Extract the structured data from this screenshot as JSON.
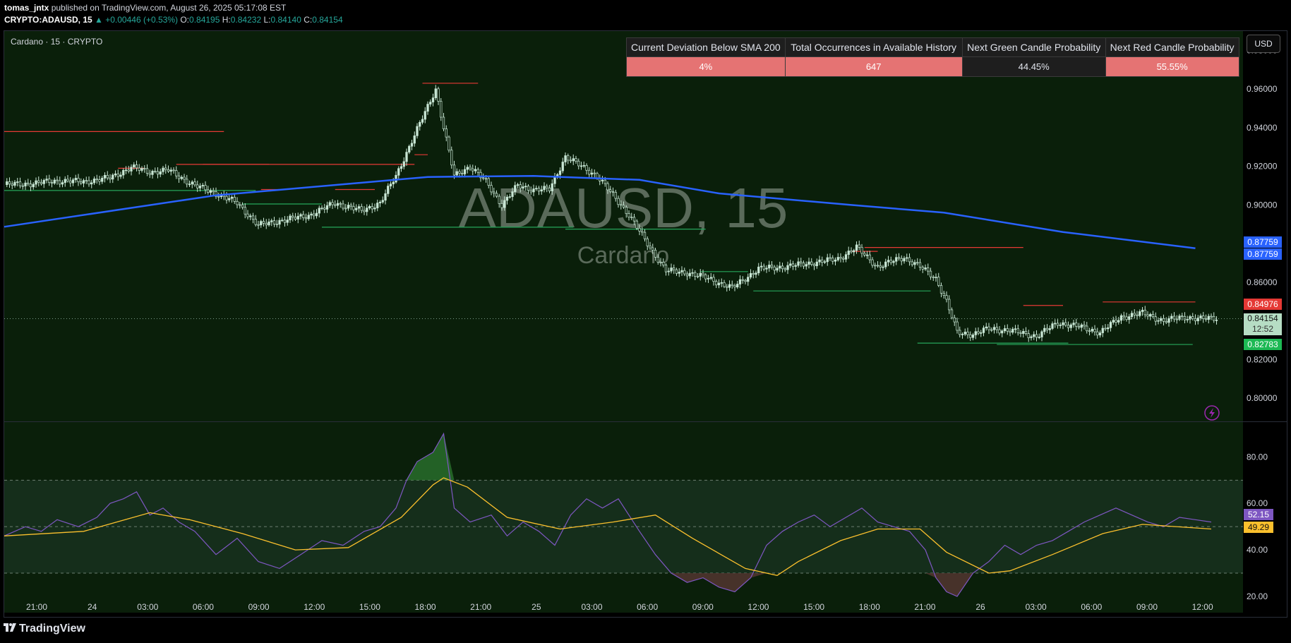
{
  "header": {
    "author": "tomas_jntx",
    "published_text": "published on TradingView.com, August 26, 2025 05:17:08 EST",
    "symbol": "CRYPTO:ADAUSD, 15",
    "change": "▲ +0.00446 (+0.53%)",
    "o_label": "O:",
    "o_value": "0.84195",
    "h_label": "H:",
    "h_value": "0.84232",
    "l_label": "L:",
    "l_value": "0.84140",
    "c_label": "C:",
    "c_value": "0.84154"
  },
  "pane_title": "Cardano · 15 · CRYPTO",
  "watermark": {
    "symbol": "ADAUSD, 15",
    "name": "Cardano"
  },
  "currency_button": "USD",
  "table": {
    "headers": [
      "Current Deviation Below SMA 200",
      "Total Occurrences in Available History",
      "Next Green Candle Probability",
      "Next Red Candle Probability"
    ],
    "values": [
      "4%",
      "647",
      "44.45%",
      "55.55%"
    ]
  },
  "badges": {
    "sma1": "0.87759",
    "sma2": "0.87759",
    "resistance": "0.84976",
    "last_price": "0.84154",
    "countdown": "12:52",
    "support": "0.82783",
    "rsi": "52.15",
    "rsi_ma": "49.29"
  },
  "colors": {
    "background": "#0a1f0a",
    "bull": "#c8e6d4",
    "bear": "#0a1f0a",
    "sma": "#2962ff",
    "resistance": "#e53935",
    "support": "#26a65b",
    "rsi": "#7e57c2",
    "rsi_ma": "#fbc02d"
  },
  "footer": {
    "brand": "TradingView"
  },
  "chart_data": [
    {
      "type": "candlestick",
      "title": "Cardano · 15 · CRYPTO",
      "ylim": [
        0.788,
        0.99
      ],
      "y_ticks": [
        "0.98000",
        "0.96000",
        "0.94000",
        "0.92000",
        "0.90000",
        "0.88000",
        "0.86000",
        "0.84000",
        "0.82000",
        "0.80000"
      ],
      "x_ticks": [
        "21:00",
        "24",
        "03:00",
        "06:00",
        "09:00",
        "12:00",
        "15:00",
        "18:00",
        "21:00",
        "25",
        "03:00",
        "06:00",
        "09:00",
        "12:00",
        "15:00",
        "18:00",
        "21:00",
        "26",
        "03:00",
        "06:00",
        "09:00",
        "12:00"
      ],
      "close_path": [
        [
          0,
          0.9105
        ],
        [
          10,
          0.911
        ],
        [
          20,
          0.9125
        ],
        [
          30,
          0.912
        ],
        [
          40,
          0.914
        ],
        [
          48,
          0.9195
        ],
        [
          55,
          0.917
        ],
        [
          62,
          0.918
        ],
        [
          72,
          0.91
        ],
        [
          80,
          0.906
        ],
        [
          88,
          0.901
        ],
        [
          96,
          0.8895
        ],
        [
          105,
          0.892
        ],
        [
          115,
          0.8945
        ],
        [
          125,
          0.901
        ],
        [
          135,
          0.897
        ],
        [
          142,
          0.901
        ],
        [
          148,
          0.915
        ],
        [
          153,
          0.93
        ],
        [
          158,
          0.945
        ],
        [
          163,
          0.96
        ],
        [
          166,
          0.94
        ],
        [
          170,
          0.915
        ],
        [
          176,
          0.92
        ],
        [
          182,
          0.912
        ],
        [
          188,
          0.9
        ],
        [
          194,
          0.91
        ],
        [
          200,
          0.908
        ],
        [
          206,
          0.908
        ],
        [
          212,
          0.925
        ],
        [
          218,
          0.92
        ],
        [
          224,
          0.915
        ],
        [
          230,
          0.905
        ],
        [
          236,
          0.895
        ],
        [
          242,
          0.882
        ],
        [
          250,
          0.866
        ],
        [
          258,
          0.865
        ],
        [
          266,
          0.862
        ],
        [
          275,
          0.857
        ],
        [
          285,
          0.867
        ],
        [
          295,
          0.868
        ],
        [
          305,
          0.87
        ],
        [
          315,
          0.872
        ],
        [
          322,
          0.878
        ],
        [
          330,
          0.868
        ],
        [
          340,
          0.873
        ],
        [
          346,
          0.868
        ],
        [
          352,
          0.862
        ],
        [
          356,
          0.85
        ],
        [
          360,
          0.834
        ],
        [
          366,
          0.833
        ],
        [
          372,
          0.836
        ],
        [
          380,
          0.835
        ],
        [
          390,
          0.832
        ],
        [
          398,
          0.839
        ],
        [
          406,
          0.837
        ],
        [
          414,
          0.834
        ],
        [
          422,
          0.842
        ],
        [
          430,
          0.844
        ],
        [
          438,
          0.84
        ],
        [
          446,
          0.842
        ],
        [
          452,
          0.841
        ],
        [
          458,
          0.8415
        ]
      ],
      "resistance_levels": [
        [
          0,
          83,
          0.938
        ],
        [
          65,
          155,
          0.921
        ],
        [
          75,
          100,
          0.921
        ],
        [
          158,
          179,
          0.963
        ],
        [
          125,
          140,
          0.908
        ],
        [
          155,
          160,
          0.926
        ],
        [
          325,
          385,
          0.878
        ],
        [
          320,
          330,
          0.876
        ],
        [
          415,
          450,
          0.8498
        ],
        [
          385,
          400,
          0.848
        ],
        [
          43,
          53,
          0.919
        ],
        [
          97,
          104,
          0.908
        ]
      ],
      "support_levels": [
        [
          0,
          95,
          0.9075
        ],
        [
          90,
          120,
          0.9005
        ],
        [
          120,
          215,
          0.8885
        ],
        [
          212,
          265,
          0.8875
        ],
        [
          263,
          281,
          0.8655
        ],
        [
          283,
          350,
          0.8555
        ],
        [
          345,
          402,
          0.8285
        ],
        [
          375,
          449,
          0.8278
        ]
      ],
      "sma_200": [
        [
          0,
          0.8887
        ],
        [
          80,
          0.905
        ],
        [
          160,
          0.9145
        ],
        [
          200,
          0.915
        ],
        [
          240,
          0.913
        ],
        [
          270,
          0.906
        ],
        [
          320,
          0.9
        ],
        [
          355,
          0.896
        ],
        [
          400,
          0.886
        ],
        [
          450,
          0.8776
        ]
      ]
    },
    {
      "type": "line",
      "title": "RSI",
      "ylim": [
        13,
        95
      ],
      "y_ticks": [
        "80.00",
        "60.00",
        "40.00",
        "20.00"
      ],
      "bands": [
        30,
        50,
        70
      ],
      "rsi": [
        [
          0,
          46
        ],
        [
          8,
          50
        ],
        [
          14,
          48
        ],
        [
          20,
          53
        ],
        [
          28,
          50
        ],
        [
          35,
          54
        ],
        [
          40,
          60
        ],
        [
          45,
          62
        ],
        [
          50,
          65
        ],
        [
          55,
          55
        ],
        [
          60,
          58
        ],
        [
          66,
          52
        ],
        [
          72,
          48
        ],
        [
          80,
          38
        ],
        [
          88,
          45
        ],
        [
          96,
          35
        ],
        [
          104,
          32
        ],
        [
          112,
          38
        ],
        [
          120,
          44
        ],
        [
          128,
          42
        ],
        [
          136,
          48
        ],
        [
          142,
          50
        ],
        [
          148,
          58
        ],
        [
          152,
          70
        ],
        [
          156,
          78
        ],
        [
          162,
          82
        ],
        [
          166,
          90
        ],
        [
          170,
          58
        ],
        [
          176,
          52
        ],
        [
          184,
          55
        ],
        [
          190,
          46
        ],
        [
          196,
          52
        ],
        [
          202,
          48
        ],
        [
          208,
          42
        ],
        [
          214,
          55
        ],
        [
          220,
          62
        ],
        [
          226,
          58
        ],
        [
          232,
          62
        ],
        [
          240,
          48
        ],
        [
          246,
          38
        ],
        [
          252,
          30
        ],
        [
          258,
          26
        ],
        [
          264,
          28
        ],
        [
          270,
          24
        ],
        [
          276,
          22
        ],
        [
          282,
          28
        ],
        [
          288,
          42
        ],
        [
          294,
          48
        ],
        [
          300,
          52
        ],
        [
          306,
          55
        ],
        [
          312,
          50
        ],
        [
          318,
          54
        ],
        [
          324,
          58
        ],
        [
          330,
          52
        ],
        [
          336,
          50
        ],
        [
          342,
          48
        ],
        [
          348,
          40
        ],
        [
          352,
          28
        ],
        [
          356,
          22
        ],
        [
          360,
          20
        ],
        [
          366,
          30
        ],
        [
          372,
          35
        ],
        [
          378,
          42
        ],
        [
          384,
          38
        ],
        [
          390,
          42
        ],
        [
          396,
          44
        ],
        [
          402,
          48
        ],
        [
          408,
          52
        ],
        [
          414,
          55
        ],
        [
          420,
          58
        ],
        [
          426,
          55
        ],
        [
          432,
          52
        ],
        [
          438,
          50
        ],
        [
          444,
          54
        ],
        [
          450,
          53
        ],
        [
          456,
          52
        ]
      ],
      "rsi_ma": [
        [
          0,
          46
        ],
        [
          30,
          48
        ],
        [
          55,
          56
        ],
        [
          70,
          53
        ],
        [
          90,
          47
        ],
        [
          110,
          40
        ],
        [
          130,
          41
        ],
        [
          150,
          54
        ],
        [
          162,
          68
        ],
        [
          166,
          71
        ],
        [
          175,
          67
        ],
        [
          190,
          54
        ],
        [
          210,
          49
        ],
        [
          230,
          52
        ],
        [
          246,
          55
        ],
        [
          260,
          45
        ],
        [
          280,
          32
        ],
        [
          292,
          29
        ],
        [
          300,
          35
        ],
        [
          316,
          44
        ],
        [
          330,
          49
        ],
        [
          346,
          49
        ],
        [
          356,
          39
        ],
        [
          372,
          30
        ],
        [
          380,
          31
        ],
        [
          396,
          38
        ],
        [
          415,
          47
        ],
        [
          430,
          51
        ],
        [
          456,
          49
        ]
      ]
    }
  ]
}
